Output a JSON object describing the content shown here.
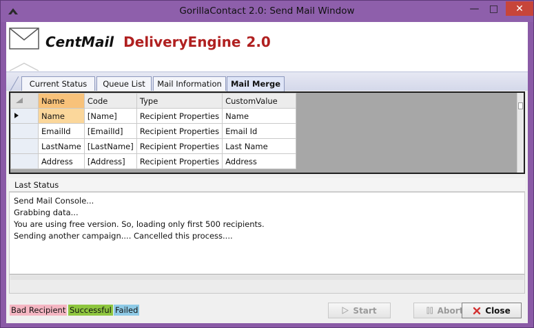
{
  "window": {
    "title": "GorillaContact 2.0: Send Mail Window",
    "controls": {
      "minimize": "—",
      "maximize": "□",
      "close": "✕"
    }
  },
  "brand": {
    "part1": "CentMail",
    "part2": "DeliveryEngine",
    "part3": "2.0"
  },
  "tabs": [
    {
      "label": "Current Status",
      "active": false
    },
    {
      "label": "Queue List",
      "active": false
    },
    {
      "label": "Mail Information",
      "active": false
    },
    {
      "label": "Mail Merge",
      "active": true
    }
  ],
  "grid": {
    "columns": [
      "Name",
      "Code",
      "Type",
      "CustomValue"
    ],
    "rows": [
      [
        "Name",
        "[Name]",
        "Recipient Properties",
        "Name"
      ],
      [
        "EmailId",
        "[EmailId]",
        "Recipient Properties",
        "Email Id"
      ],
      [
        "LastName",
        "[LastName]",
        "Recipient Properties",
        "Last Name"
      ],
      [
        "Address",
        "[Address]",
        "Recipient Properties",
        "Address"
      ]
    ]
  },
  "status": {
    "header": "Last Status",
    "lines": [
      "Send Mail Console...",
      "Grabbing data...",
      "You are using free version. So, loading only first 500 recipients.",
      "Sending another campaign.... Cancelled this process...."
    ]
  },
  "legend": {
    "bad": "Bad Recipient",
    "success": "Successful",
    "failed": "Failed"
  },
  "buttons": {
    "start": "Start",
    "abort": "Abort",
    "close": "Close"
  },
  "colors": {
    "window_frame": "#8a5aa6",
    "close_button": "#c7453a",
    "brand_red": "#b02020",
    "bad_recipient": "#f4b6c2",
    "successful": "#8ec63f",
    "failed": "#8ecae6",
    "selected_header": "#f8c27a"
  }
}
